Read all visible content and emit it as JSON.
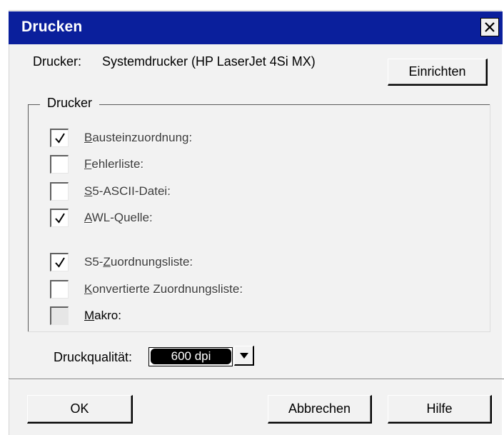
{
  "window": {
    "title": "Drucken"
  },
  "printer": {
    "label": "Drucker:",
    "value": "Systemdrucker (HP LaserJet 4Si MX)"
  },
  "buttons": {
    "setup": "Einrichten",
    "ok": "OK",
    "cancel": "Abbrechen",
    "help": "Hilfe"
  },
  "group": {
    "title": "Drucker"
  },
  "checkboxes": [
    {
      "accel": "B",
      "rest": "austeinzuordnung:",
      "prefix": "",
      "checked": true,
      "enabled": true
    },
    {
      "accel": "F",
      "rest": "ehlerliste:",
      "prefix": "",
      "checked": false,
      "enabled": true
    },
    {
      "accel": "S",
      "rest": "5-ASCII-Datei:",
      "prefix": "",
      "checked": false,
      "enabled": true
    },
    {
      "accel": "A",
      "rest": "WL-Quelle:",
      "prefix": "",
      "checked": true,
      "enabled": true
    },
    {
      "accel": "Z",
      "rest": "uordnungsliste:",
      "prefix": "S5-",
      "checked": true,
      "enabled": true
    },
    {
      "accel": "K",
      "rest": "onvertierte Zuordnungsliste:",
      "prefix": "",
      "checked": false,
      "enabled": true
    },
    {
      "accel": "M",
      "rest": "akro:",
      "prefix": "",
      "checked": false,
      "enabled": false
    }
  ],
  "quality": {
    "label": "Druckqualität:",
    "value": "600 dpi"
  },
  "icons": {
    "close": "close-icon",
    "check": "checkmark-icon",
    "dropdown": "dropdown-arrow-icon"
  }
}
